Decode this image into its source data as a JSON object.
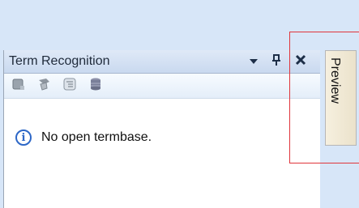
{
  "panel": {
    "title": "Term Recognition",
    "buttons": {
      "dropdown_icon": "chevron-down-icon",
      "pin_icon": "pin-icon",
      "close_icon": "close-icon"
    },
    "toolbar": [
      {
        "icon": "termbase-icon"
      },
      {
        "icon": "search-term-icon"
      },
      {
        "icon": "settings-tree-icon"
      },
      {
        "icon": "database-icon"
      }
    ],
    "message": "No open termbase.",
    "message_icon": "info-icon"
  },
  "side_tab": {
    "label": "Preview"
  },
  "colors": {
    "highlight": "#e0353b",
    "info_blue": "#2d67c7"
  }
}
